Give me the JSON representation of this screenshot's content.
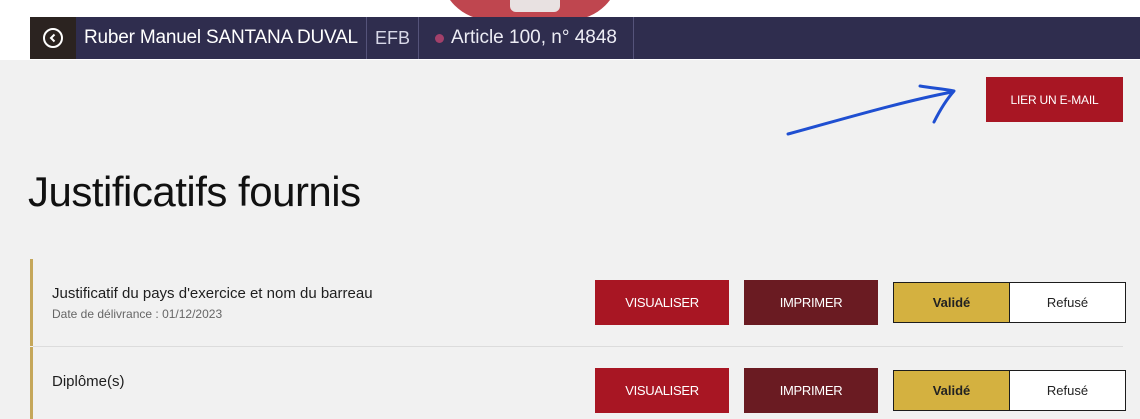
{
  "header": {
    "back_icon": "chevron-left-circle-icon",
    "name": "Ruber Manuel SANTANA DUVAL",
    "org": "EFB",
    "article": "Article 100, n° 4848",
    "article_dot_color": "#a3406a"
  },
  "actions": {
    "link_email_label": "LIER UN E-MAIL"
  },
  "page_title": "Justificatifs fournis",
  "documents": [
    {
      "title": "Justificatif du pays d'exercice et nom du barreau",
      "date": "Date de délivrance : 01/12/2023",
      "view_label": "VISUALISER",
      "print_label": "IMPRIMER",
      "valid_label": "Validé",
      "refuse_label": "Refusé",
      "status": "Validé"
    },
    {
      "title": "Diplôme(s)",
      "date": "",
      "view_label": "VISUALISER",
      "print_label": "IMPRIMER",
      "valid_label": "Validé",
      "refuse_label": "Refusé",
      "status": "Validé"
    }
  ],
  "colors": {
    "primary_red": "#a81623",
    "dark_red": "#6a1b22",
    "gold": "#d4b140",
    "navy": "#2f2d4e",
    "annotation_arrow": "#1f4fd1"
  }
}
